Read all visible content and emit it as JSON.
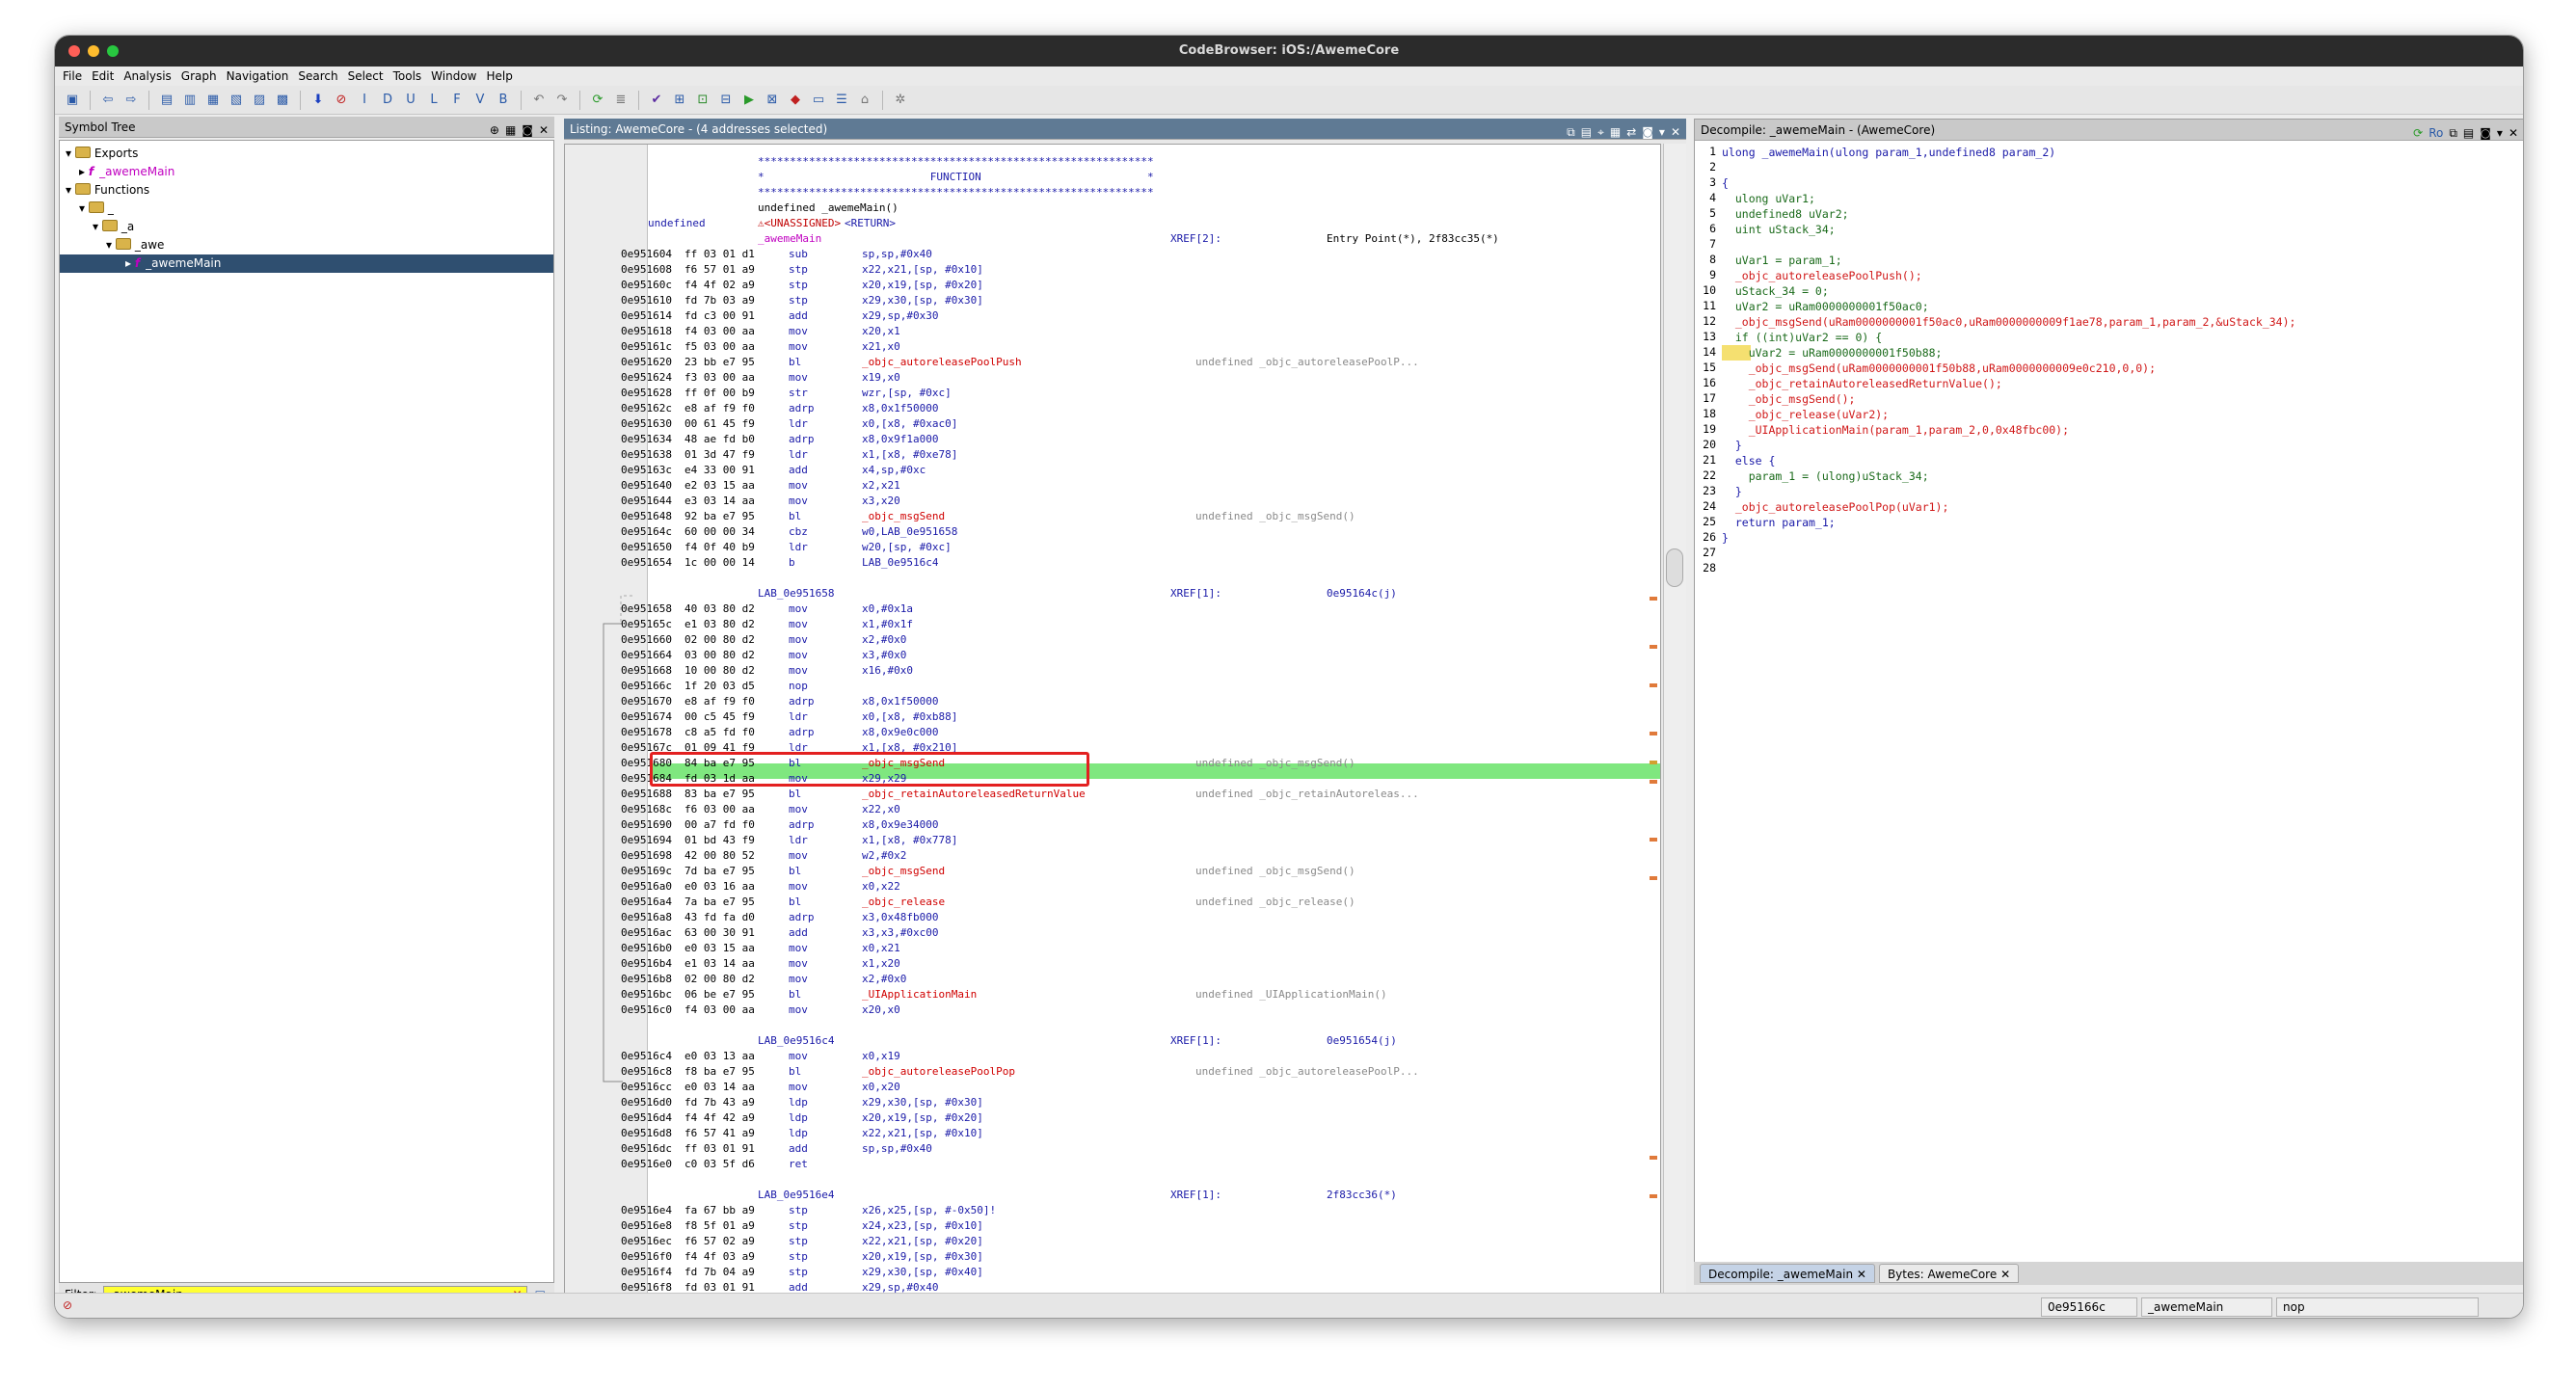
{
  "window": {
    "title": "CodeBrowser: iOS:/AwemeCore"
  },
  "menu": [
    "File",
    "Edit",
    "Analysis",
    "Graph",
    "Navigation",
    "Search",
    "Select",
    "Tools",
    "Window",
    "Help"
  ],
  "symbol_tree": {
    "title": "Symbol Tree",
    "rows": [
      "Exports",
      "_awemeMain",
      "Functions",
      "_",
      "_a",
      "_awe",
      "_awemeMain"
    ],
    "filter_label": "Filter:",
    "filter_value": "_awemeMain"
  },
  "listing": {
    "title": "Listing:  AwemeCore - (4 addresses selected)",
    "header_stars": "**************************************************************",
    "header_function": "*                          FUNCTION                          *",
    "header_sig": "undefined _awemeMain()",
    "header_undefined": "undefined",
    "header_unassigned": "<UNASSIGNED>",
    "header_return": "<RETURN>",
    "func_label": "_awemeMain",
    "func_xref": "XREF[2]:",
    "func_xref_val": "Entry Point(*), 2f83cc35(*)",
    "lines": [
      {
        "a": "0e951604",
        "b": "ff 03 01 d1",
        "m": "sub",
        "o": "sp,sp,#0x40"
      },
      {
        "a": "0e951608",
        "b": "f6 57 01 a9",
        "m": "stp",
        "o": "x22,x21,[sp, #0x10]"
      },
      {
        "a": "0e95160c",
        "b": "f4 4f 02 a9",
        "m": "stp",
        "o": "x20,x19,[sp, #0x20]"
      },
      {
        "a": "0e951610",
        "b": "fd 7b 03 a9",
        "m": "stp",
        "o": "x29,x30,[sp, #0x30]"
      },
      {
        "a": "0e951614",
        "b": "fd c3 00 91",
        "m": "add",
        "o": "x29,sp,#0x30"
      },
      {
        "a": "0e951618",
        "b": "f4 03 00 aa",
        "m": "mov",
        "o": "x20,x1"
      },
      {
        "a": "0e95161c",
        "b": "f5 03 00 aa",
        "m": "mov",
        "o": "x21,x0"
      },
      {
        "a": "0e951620",
        "b": "23 bb e7 95",
        "m": "bl",
        "o": "_objc_autoreleasePoolPush",
        "c": "undefined _objc_autoreleasePoolP..."
      },
      {
        "a": "0e951624",
        "b": "f3 03 00 aa",
        "m": "mov",
        "o": "x19,x0"
      },
      {
        "a": "0e951628",
        "b": "ff 0f 00 b9",
        "m": "str",
        "o": "wzr,[sp, #0xc]"
      },
      {
        "a": "0e95162c",
        "b": "e8 af f9 f0",
        "m": "adrp",
        "o": "x8,0x1f50000"
      },
      {
        "a": "0e951630",
        "b": "00 61 45 f9",
        "m": "ldr",
        "o": "x0,[x8, #0xac0]"
      },
      {
        "a": "0e951634",
        "b": "48 ae fd b0",
        "m": "adrp",
        "o": "x8,0x9f1a000"
      },
      {
        "a": "0e951638",
        "b": "01 3d 47 f9",
        "m": "ldr",
        "o": "x1,[x8, #0xe78]"
      },
      {
        "a": "0e95163c",
        "b": "e4 33 00 91",
        "m": "add",
        "o": "x4,sp,#0xc"
      },
      {
        "a": "0e951640",
        "b": "e2 03 15 aa",
        "m": "mov",
        "o": "x2,x21"
      },
      {
        "a": "0e951644",
        "b": "e3 03 14 aa",
        "m": "mov",
        "o": "x3,x20"
      },
      {
        "a": "0e951648",
        "b": "92 ba e7 95",
        "m": "bl",
        "o": "_objc_msgSend",
        "c": "undefined _objc_msgSend()"
      },
      {
        "a": "0e95164c",
        "b": "60 00 00 34",
        "m": "cbz",
        "o": "w0,LAB_0e951658"
      },
      {
        "a": "0e951650",
        "b": "f4 0f 40 b9",
        "m": "ldr",
        "o": "w20,[sp, #0xc]"
      },
      {
        "a": "0e951654",
        "b": "1c 00 00 14",
        "m": "b",
        "o": "LAB_0e9516c4"
      },
      {
        "lab": "LAB_0e951658",
        "x": "XREF[1]:",
        "xv": "0e95164c(j)"
      },
      {
        "a": "0e951658",
        "b": "40 03 80 d2",
        "m": "mov",
        "o": "x0,#0x1a"
      },
      {
        "a": "0e95165c",
        "b": "e1 03 80 d2",
        "m": "mov",
        "o": "x1,#0x1f"
      },
      {
        "a": "0e951660",
        "b": "02 00 80 d2",
        "m": "mov",
        "o": "x2,#0x0"
      },
      {
        "a": "0e951664",
        "b": "03 00 80 d2",
        "m": "mov",
        "o": "x3,#0x0"
      },
      {
        "a": "0e951668",
        "b": "10 00 80 d2",
        "m": "mov",
        "o": "x16,#0x0"
      },
      {
        "a": "0e95166c",
        "b": "1f 20 03 d5",
        "m": "nop",
        "o": "",
        "hl": true
      },
      {
        "a": "0e951670",
        "b": "e8 af f9 f0",
        "m": "adrp",
        "o": "x8,0x1f50000"
      },
      {
        "a": "0e951674",
        "b": "00 c5 45 f9",
        "m": "ldr",
        "o": "x0,[x8, #0xb88]"
      },
      {
        "a": "0e951678",
        "b": "c8 a5 fd f0",
        "m": "adrp",
        "o": "x8,0x9e0c000"
      },
      {
        "a": "0e95167c",
        "b": "01 09 41 f9",
        "m": "ldr",
        "o": "x1,[x8, #0x210]"
      },
      {
        "a": "0e951680",
        "b": "84 ba e7 95",
        "m": "bl",
        "o": "_objc_msgSend",
        "c": "undefined _objc_msgSend()"
      },
      {
        "a": "0e951684",
        "b": "fd 03 1d aa",
        "m": "mov",
        "o": "x29,x29"
      },
      {
        "a": "0e951688",
        "b": "83 ba e7 95",
        "m": "bl",
        "o": "_objc_retainAutoreleasedReturnValue",
        "c": "undefined _objc_retainAutoreleas..."
      },
      {
        "a": "0e95168c",
        "b": "f6 03 00 aa",
        "m": "mov",
        "o": "x22,x0"
      },
      {
        "a": "0e951690",
        "b": "00 a7 fd f0",
        "m": "adrp",
        "o": "x8,0x9e34000"
      },
      {
        "a": "0e951694",
        "b": "01 bd 43 f9",
        "m": "ldr",
        "o": "x1,[x8, #0x778]"
      },
      {
        "a": "0e951698",
        "b": "42 00 80 52",
        "m": "mov",
        "o": "w2,#0x2"
      },
      {
        "a": "0e95169c",
        "b": "7d ba e7 95",
        "m": "bl",
        "o": "_objc_msgSend",
        "c": "undefined _objc_msgSend()"
      },
      {
        "a": "0e9516a0",
        "b": "e0 03 16 aa",
        "m": "mov",
        "o": "x0,x22"
      },
      {
        "a": "0e9516a4",
        "b": "7a ba e7 95",
        "m": "bl",
        "o": "_objc_release",
        "c": "undefined _objc_release()"
      },
      {
        "a": "0e9516a8",
        "b": "43 fd fa d0",
        "m": "adrp",
        "o": "x3,0x48fb000"
      },
      {
        "a": "0e9516ac",
        "b": "63 00 30 91",
        "m": "add",
        "o": "x3,x3,#0xc00"
      },
      {
        "a": "0e9516b0",
        "b": "e0 03 15 aa",
        "m": "mov",
        "o": "x0,x21"
      },
      {
        "a": "0e9516b4",
        "b": "e1 03 14 aa",
        "m": "mov",
        "o": "x1,x20"
      },
      {
        "a": "0e9516b8",
        "b": "02 00 80 d2",
        "m": "mov",
        "o": "x2,#0x0"
      },
      {
        "a": "0e9516bc",
        "b": "06 be e7 95",
        "m": "bl",
        "o": "_UIApplicationMain",
        "c": "undefined _UIApplicationMain()"
      },
      {
        "a": "0e9516c0",
        "b": "f4 03 00 aa",
        "m": "mov",
        "o": "x20,x0"
      },
      {
        "lab": "LAB_0e9516c4",
        "x": "XREF[1]:",
        "xv": "0e951654(j)"
      },
      {
        "a": "0e9516c4",
        "b": "e0 03 13 aa",
        "m": "mov",
        "o": "x0,x19"
      },
      {
        "a": "0e9516c8",
        "b": "f8 ba e7 95",
        "m": "bl",
        "o": "_objc_autoreleasePoolPop",
        "c": "undefined _objc_autoreleasePoolP..."
      },
      {
        "a": "0e9516cc",
        "b": "e0 03 14 aa",
        "m": "mov",
        "o": "x0,x20"
      },
      {
        "a": "0e9516d0",
        "b": "fd 7b 43 a9",
        "m": "ldp",
        "o": "x29,x30,[sp, #0x30]"
      },
      {
        "a": "0e9516d4",
        "b": "f4 4f 42 a9",
        "m": "ldp",
        "o": "x20,x19,[sp, #0x20]"
      },
      {
        "a": "0e9516d8",
        "b": "f6 57 41 a9",
        "m": "ldp",
        "o": "x22,x21,[sp, #0x10]"
      },
      {
        "a": "0e9516dc",
        "b": "ff 03 01 91",
        "m": "add",
        "o": "sp,sp,#0x40"
      },
      {
        "a": "0e9516e0",
        "b": "c0 03 5f d6",
        "m": "ret",
        "o": ""
      },
      {
        "lab": "LAB_0e9516e4",
        "x": "XREF[1]:",
        "xv": "2f83cc36(*)"
      },
      {
        "a": "0e9516e4",
        "b": "fa 67 bb a9",
        "m": "stp",
        "o": "x26,x25,[sp, #-0x50]!"
      },
      {
        "a": "0e9516e8",
        "b": "f8 5f 01 a9",
        "m": "stp",
        "o": "x24,x23,[sp, #0x10]"
      },
      {
        "a": "0e9516ec",
        "b": "f6 57 02 a9",
        "m": "stp",
        "o": "x22,x21,[sp, #0x20]"
      },
      {
        "a": "0e9516f0",
        "b": "f4 4f 03 a9",
        "m": "stp",
        "o": "x20,x19,[sp, #0x30]"
      },
      {
        "a": "0e9516f4",
        "b": "fd 7b 04 a9",
        "m": "stp",
        "o": "x29,x30,[sp, #0x40]"
      },
      {
        "a": "0e9516f8",
        "b": "fd 03 01 91",
        "m": "add",
        "o": "x29,sp,#0x40"
      }
    ]
  },
  "decompile": {
    "title": "Decompile: _awemeMain -  (AwemeCore)",
    "lines": [
      "ulong _awemeMain(ulong param_1,undefined8 param_2)",
      "",
      "{",
      "  ulong uVar1;",
      "  undefined8 uVar2;",
      "  uint uStack_34;",
      "",
      "  uVar1 = param_1;",
      "  _objc_autoreleasePoolPush();",
      "  uStack_34 = 0;",
      "  uVar2 = uRam0000000001f50ac0;",
      "  _objc_msgSend(uRam0000000001f50ac0,uRam0000000009f1ae78,param_1,param_2,&uStack_34);",
      "  if ((int)uVar2 == 0) {",
      "    uVar2 = uRam0000000001f50b88;",
      "    _objc_msgSend(uRam0000000001f50b88,uRam0000000009e0c210,0,0);",
      "    _objc_retainAutoreleasedReturnValue();",
      "    _objc_msgSend();",
      "    _objc_release(uVar2);",
      "    _UIApplicationMain(param_1,param_2,0,0x48fbc00);",
      "  }",
      "  else {",
      "    param_1 = (ulong)uStack_34;",
      "  }",
      "  _objc_autoreleasePoolPop(uVar1);",
      "  return param_1;",
      "}",
      "",
      ""
    ],
    "tabs": [
      "Decompile: _awemeMain",
      "Bytes: AwemeCore"
    ]
  },
  "status": {
    "address": "0e95166c",
    "function": "_awemeMain",
    "instruction": "nop"
  }
}
